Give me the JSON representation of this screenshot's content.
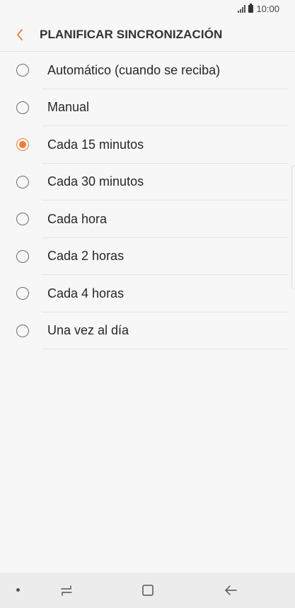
{
  "status_bar": {
    "time": "10:00",
    "signal_icon": "signal-icon",
    "battery_icon": "battery-icon"
  },
  "header": {
    "back_icon": "chevron-left-icon",
    "title": "PLANIFICAR SINCRONIZACIÓN"
  },
  "options": [
    {
      "label": "Automático (cuando se reciba)",
      "selected": false
    },
    {
      "label": "Manual",
      "selected": false
    },
    {
      "label": "Cada 15 minutos",
      "selected": true
    },
    {
      "label": "Cada 30 minutos",
      "selected": false
    },
    {
      "label": "Cada hora",
      "selected": false
    },
    {
      "label": "Cada 2 horas",
      "selected": false
    },
    {
      "label": "Cada 4 horas",
      "selected": false
    },
    {
      "label": "Una vez al día",
      "selected": false
    }
  ],
  "nav_bar": {
    "dot_icon": "dot-icon",
    "recents_icon": "recent-apps-icon",
    "home_icon": "home-icon",
    "back_icon": "back-arrow-icon"
  },
  "colors": {
    "accent": "#f07c3a",
    "background": "#f7f7f7",
    "nav_background": "#ececec",
    "divider": "#e3e3e3"
  }
}
